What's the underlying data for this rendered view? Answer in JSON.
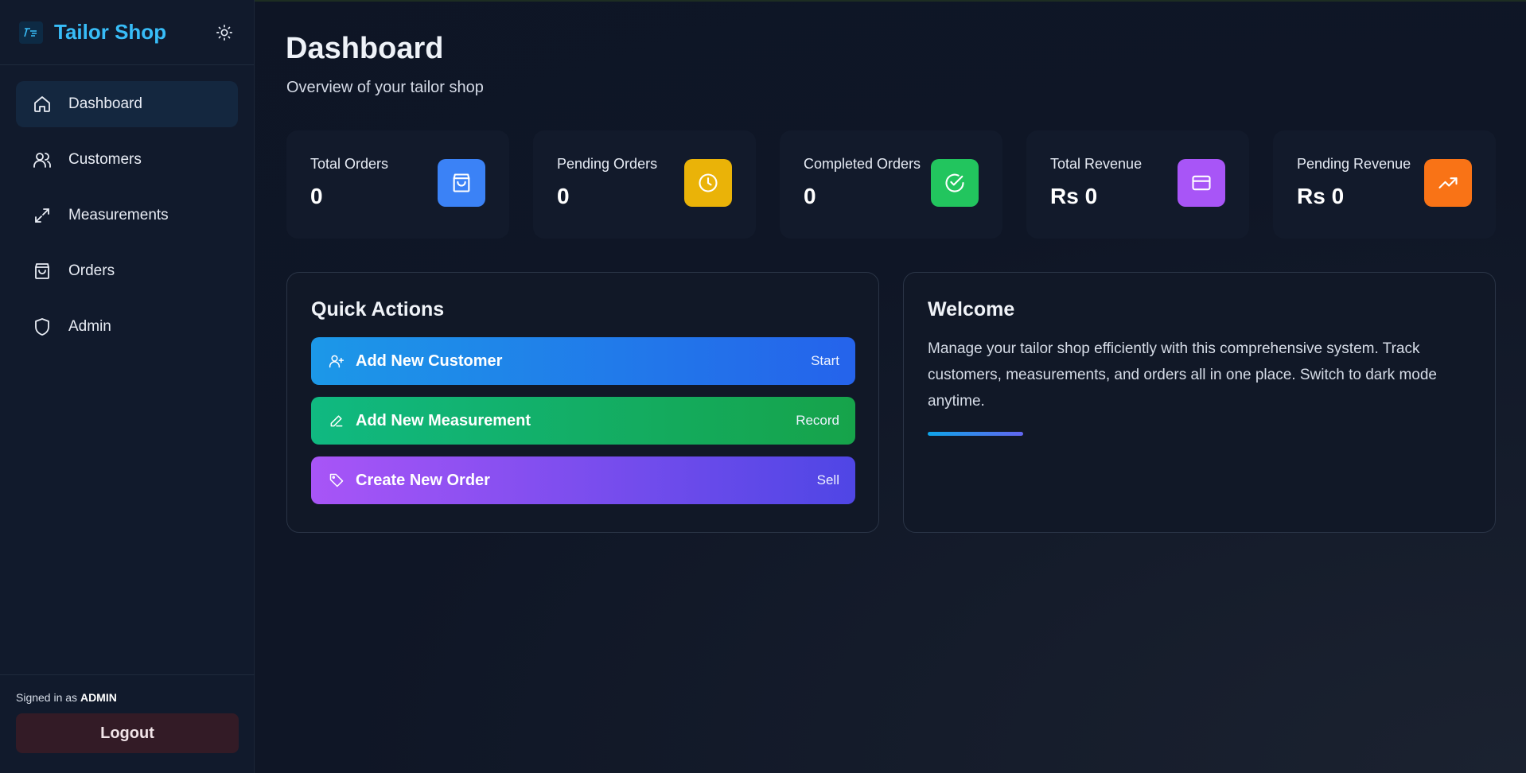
{
  "sidebar": {
    "brand": "Tailor Shop",
    "nav": [
      {
        "label": "Dashboard",
        "icon": "home-icon",
        "active": true
      },
      {
        "label": "Customers",
        "icon": "users-icon",
        "active": false
      },
      {
        "label": "Measurements",
        "icon": "expand-arrows-icon",
        "active": false
      },
      {
        "label": "Orders",
        "icon": "shopping-bag-icon",
        "active": false
      },
      {
        "label": "Admin",
        "icon": "shield-icon",
        "active": false
      }
    ],
    "signed_in_prefix": "Signed in as",
    "signed_in_user": "ADMIN",
    "logout_label": "Logout"
  },
  "header": {
    "title": "Dashboard",
    "subtitle": "Overview of your tailor shop"
  },
  "stats": [
    {
      "label": "Total Orders",
      "value": "0",
      "icon": "shopping-bag-icon",
      "color": "#3b82f6"
    },
    {
      "label": "Pending Orders",
      "value": "0",
      "icon": "clock-icon",
      "color": "#eab308"
    },
    {
      "label": "Completed Orders",
      "value": "0",
      "icon": "check-circle-icon",
      "color": "#22c55e"
    },
    {
      "label": "Total Revenue",
      "value": "Rs 0",
      "icon": "credit-card-icon",
      "color": "#a855f7"
    },
    {
      "label": "Pending Revenue",
      "value": "Rs 0",
      "icon": "trending-up-icon",
      "color": "#f97316"
    }
  ],
  "quick_actions": {
    "title": "Quick Actions",
    "items": [
      {
        "label": "Add New Customer",
        "hint": "Start",
        "icon": "user-plus-icon"
      },
      {
        "label": "Add New Measurement",
        "hint": "Record",
        "icon": "pencil-icon"
      },
      {
        "label": "Create New Order",
        "hint": "Sell",
        "icon": "tag-icon"
      }
    ]
  },
  "welcome": {
    "title": "Welcome",
    "text": "Manage your tailor shop efficiently with this comprehensive system. Track customers, measurements, and orders all in one place. Switch to dark mode anytime."
  }
}
